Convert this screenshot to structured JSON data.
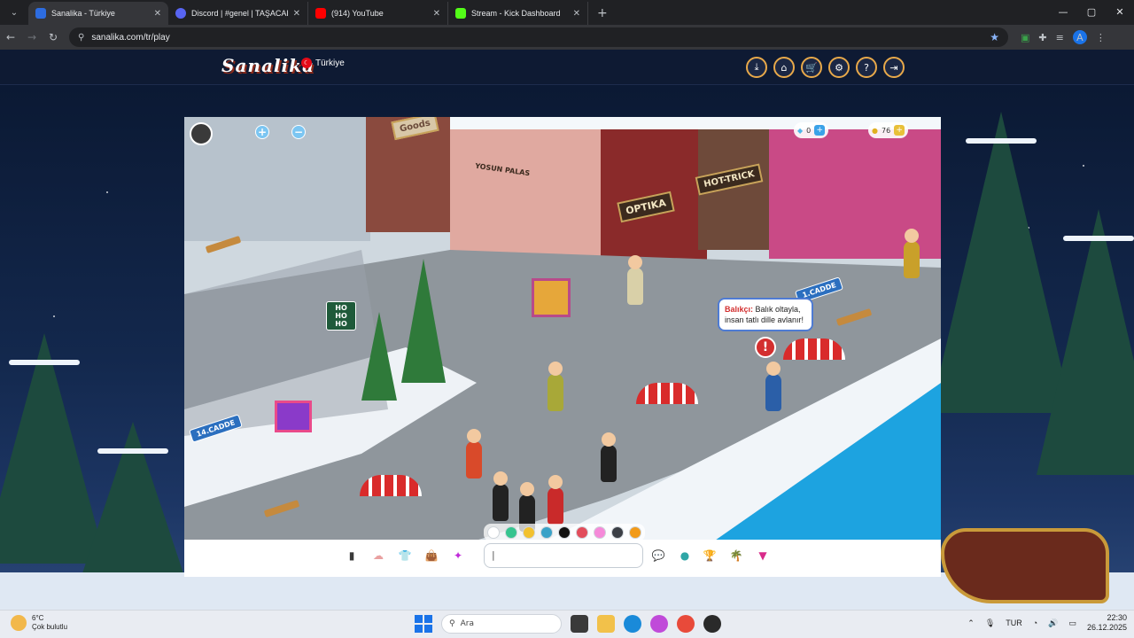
{
  "browser": {
    "tabs": [
      {
        "title": "Sanalika - Türkiye",
        "favicon_color": "#2d6cdf",
        "active": true
      },
      {
        "title": "Discord | #genel | TAŞACAK",
        "favicon_color": "#5865f2",
        "active": false
      },
      {
        "title": "(914) YouTube",
        "favicon_color": "#ff0000",
        "active": false
      },
      {
        "title": "Stream - Kick Dashboard",
        "favicon_color": "#53fc18",
        "active": false
      }
    ],
    "tab_close": "✕",
    "new_tab": "+",
    "url": "sanalika.com/tr/play",
    "window_controls": {
      "minimize": "—",
      "maximize": "▢",
      "close": "✕"
    },
    "nav": {
      "back": "←",
      "forward": "→",
      "reload": "↻"
    },
    "bookmark_icon": "★"
  },
  "site": {
    "logo": "Sanalika",
    "region": "Türkiye",
    "header_buttons": [
      {
        "name": "download-button",
        "icon": "⤓"
      },
      {
        "name": "home-button",
        "icon": "⌂"
      },
      {
        "name": "shop-button",
        "icon": "🛒"
      },
      {
        "name": "settings-button",
        "icon": "⚙"
      },
      {
        "name": "help-button",
        "icon": "?"
      },
      {
        "name": "logout-button",
        "icon": "⇥"
      }
    ]
  },
  "game": {
    "diamonds": "0",
    "coins": "76",
    "zoom_in": "+",
    "zoom_out": "−",
    "speech": {
      "speaker": "Balıkçı:",
      "text": "Balık oltayla, insan tatlı dille avlanır!"
    },
    "alert": "!",
    "street_signs": [
      "14.CADDE",
      "1.CADDE"
    ],
    "shop_signs": [
      "OPTIKA",
      "HOT-TRICK",
      "Goods",
      "YOSUN PALAS"
    ],
    "santa_sign": "HO HO HO",
    "palette": [
      "#ffffff",
      "#35c48f",
      "#f2c12e",
      "#3aa2c8",
      "#111111",
      "#e24d5b",
      "#f58ad9",
      "#3b3f46",
      "#f29a18"
    ],
    "chat_placeholder": "|",
    "toolbar_left": [
      {
        "name": "phone-icon",
        "glyph": "▮",
        "color": "#3a3a3a"
      },
      {
        "name": "friends-icon",
        "glyph": "☁",
        "color": "#e9a0a0"
      },
      {
        "name": "clothes-icon",
        "glyph": "👕",
        "color": "#3aa2e8"
      },
      {
        "name": "bag-icon",
        "glyph": "👜",
        "color": "#d9502a"
      },
      {
        "name": "dance-icon",
        "glyph": "✦",
        "color": "#c02ad9"
      }
    ],
    "toolbar_right": [
      {
        "name": "chat-bubble-icon",
        "glyph": "💬",
        "color": "#e85050"
      },
      {
        "name": "pet-icon",
        "glyph": "●",
        "color": "#2fa6a6"
      },
      {
        "name": "trophy-icon",
        "glyph": "🏆",
        "color": "#e0a020"
      },
      {
        "name": "island-icon",
        "glyph": "🌴",
        "color": "#3aa24a"
      },
      {
        "name": "menu-arrow-icon",
        "glyph": "▼",
        "color": "#d92b8a"
      }
    ]
  },
  "taskbar": {
    "weather_temp": "6°C",
    "weather_desc": "Çok bulutlu",
    "search_placeholder": "Ara",
    "language": "TUR",
    "time": "22:30",
    "date": "26.12.2025"
  },
  "colors": {
    "accent": "#1a73e8",
    "header_ring": "#e8a94a",
    "sea": "#1da3e0",
    "speech_border": "#4e7bd3"
  }
}
